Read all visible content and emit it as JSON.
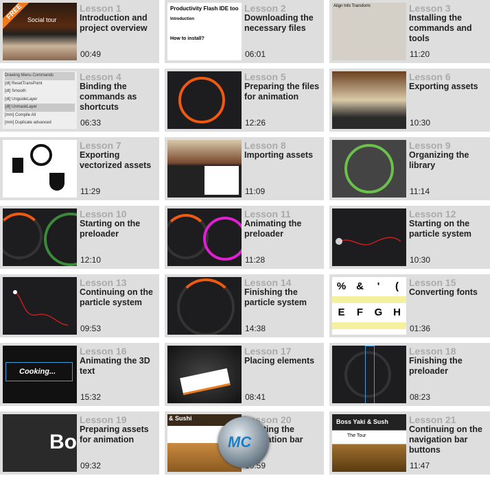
{
  "lessons": [
    {
      "number": "Lesson 1",
      "title": "Introduction and project overview",
      "duration": "00:49",
      "badge": "FREE"
    },
    {
      "number": "Lesson 2",
      "title": "Downloading the necessary files",
      "duration": "06:01"
    },
    {
      "number": "Lesson 3",
      "title": "Installing the commands and tools",
      "duration": "11:20"
    },
    {
      "number": "Lesson 4",
      "title": "Binding the commands as shortcuts",
      "duration": "06:33"
    },
    {
      "number": "Lesson 5",
      "title": "Preparing the files for animation",
      "duration": "12:26"
    },
    {
      "number": "Lesson 6",
      "title": "Exporting assets",
      "duration": "10:30"
    },
    {
      "number": "Lesson 7",
      "title": "Exporting vectorized assets",
      "duration": "11:29"
    },
    {
      "number": "Lesson 8",
      "title": "Importing assets",
      "duration": "11:09"
    },
    {
      "number": "Lesson 9",
      "title": "Organizing the library",
      "duration": "11:14"
    },
    {
      "number": "Lesson 10",
      "title": "Starting on the preloader",
      "duration": "12:10"
    },
    {
      "number": "Lesson 11",
      "title": "Animating the preloader",
      "duration": "11:28"
    },
    {
      "number": "Lesson 12",
      "title": "Starting on the particle system",
      "duration": "10:30"
    },
    {
      "number": "Lesson 13",
      "title": "Continuing on the particle system",
      "duration": "09:53"
    },
    {
      "number": "Lesson 14",
      "title": "Finishing the particle system",
      "duration": "14:38"
    },
    {
      "number": "Lesson 15",
      "title": "Converting fonts",
      "duration": "01:36"
    },
    {
      "number": "Lesson 16",
      "title": "Animating the 3D text",
      "duration": "15:32"
    },
    {
      "number": "Lesson 17",
      "title": "Placing elements",
      "duration": "08:41"
    },
    {
      "number": "Lesson 18",
      "title": "Finishing the preloader",
      "duration": "08:23"
    },
    {
      "number": "Lesson 19",
      "title": "Preparing assets for animation",
      "duration": "09:32"
    },
    {
      "number": "Lesson 20",
      "title": "Creating the navigation bar",
      "duration": "10:59"
    },
    {
      "number": "Lesson 21",
      "title": "Continuing on the navigation bar buttons",
      "duration": "11:47"
    }
  ],
  "thumbs": {
    "t1": "Social tour",
    "t2": "Productivity Flash IDE too",
    "t2b": "Introduction",
    "t2c": "How to install?",
    "t3": "Align  Info  Transform",
    "t4": [
      "Drawing Menu Commands",
      "[dt] ResetTransPoint",
      "[dt] Smooth",
      "[dt] UnguideLayer",
      "[dt] UnmaskLayer",
      "[mm] Compile All",
      "[mm] Duplicate advanced"
    ],
    "t15": [
      "%",
      "&",
      "'",
      "(",
      "E",
      "F",
      "G",
      "H"
    ],
    "t16": "Cooking...",
    "t19": "Bo",
    "t20": "& Sushi",
    "t21": "Boss Yaki & Sush",
    "t21b": "The Tour"
  },
  "watermark": "MC",
  "colors": {
    "cell": "#dedede",
    "lesson_number": "#aaaaaa",
    "orange": "#f07a1a",
    "green": "#6ac04a",
    "magenta": "#e020d0"
  }
}
